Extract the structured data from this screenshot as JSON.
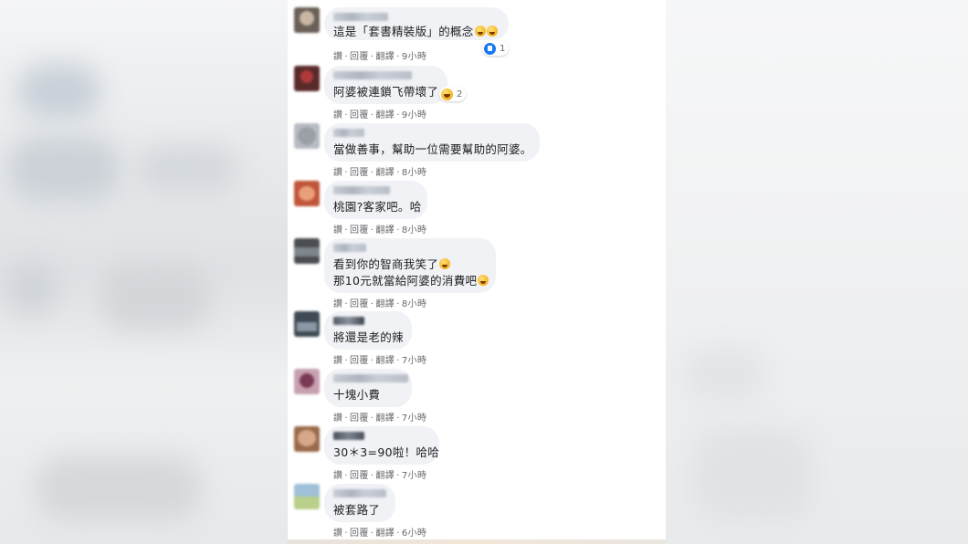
{
  "comments": [
    {
      "text_lines": [
        "這是「套書精裝版」的概念"
      ],
      "emoji_count": 2,
      "reaction": {
        "type": "like-icon",
        "count": "1"
      },
      "reply": "讚",
      "answer": "回覆",
      "translate": "翻譯",
      "time": "9小時"
    },
    {
      "text_lines": [
        "阿婆被連鎖飞帶壞了"
      ],
      "emoji_count": 0,
      "reaction": {
        "type": "haha-icon",
        "count": "2"
      },
      "reply": "讚",
      "answer": "回覆",
      "translate": "翻譯",
      "time": "9小時"
    },
    {
      "text_lines": [
        "當做善事，幫助一位需要幫助的阿婆。"
      ],
      "emoji_count": 0,
      "reaction": null,
      "reply": "讚",
      "answer": "回覆",
      "translate": "翻譯",
      "time": "8小時"
    },
    {
      "text_lines": [
        "桃園?客家吧。哈"
      ],
      "emoji_count": 0,
      "reaction": null,
      "reply": "讚",
      "answer": "回覆",
      "translate": "翻譯",
      "time": "8小時"
    },
    {
      "text_lines": [
        "看到你的智商我笑了",
        "那10元就當給阿婆的消費吧"
      ],
      "emoji_lines": [
        1,
        1
      ],
      "reaction": null,
      "reply": "讚",
      "answer": "回覆",
      "translate": "翻譯",
      "time": "8小時"
    },
    {
      "text_lines": [
        "將還是老的辣"
      ],
      "emoji_count": 0,
      "reaction": null,
      "reply": "讚",
      "answer": "回覆",
      "translate": "翻譯",
      "time": "7小時"
    },
    {
      "text_lines": [
        "十塊小費"
      ],
      "emoji_count": 0,
      "reaction": null,
      "reply": "讚",
      "answer": "回覆",
      "translate": "翻譯",
      "time": "7小時"
    },
    {
      "text_lines": [
        "30＊3=90啦！哈哈"
      ],
      "emoji_count": 0,
      "reaction": null,
      "reply": "讚",
      "answer": "回覆",
      "translate": "翻譯",
      "time": "7小時"
    },
    {
      "text_lines": [
        "被套路了"
      ],
      "emoji_count": 0,
      "reaction": null,
      "reply": "讚",
      "answer": "回覆",
      "translate": "翻譯",
      "time": "6小時"
    }
  ],
  "separator": "·",
  "colors": {
    "bubble": "#f0f2f5",
    "text": "#1c1e21",
    "meta": "#65676b",
    "like": "#1877f2"
  }
}
